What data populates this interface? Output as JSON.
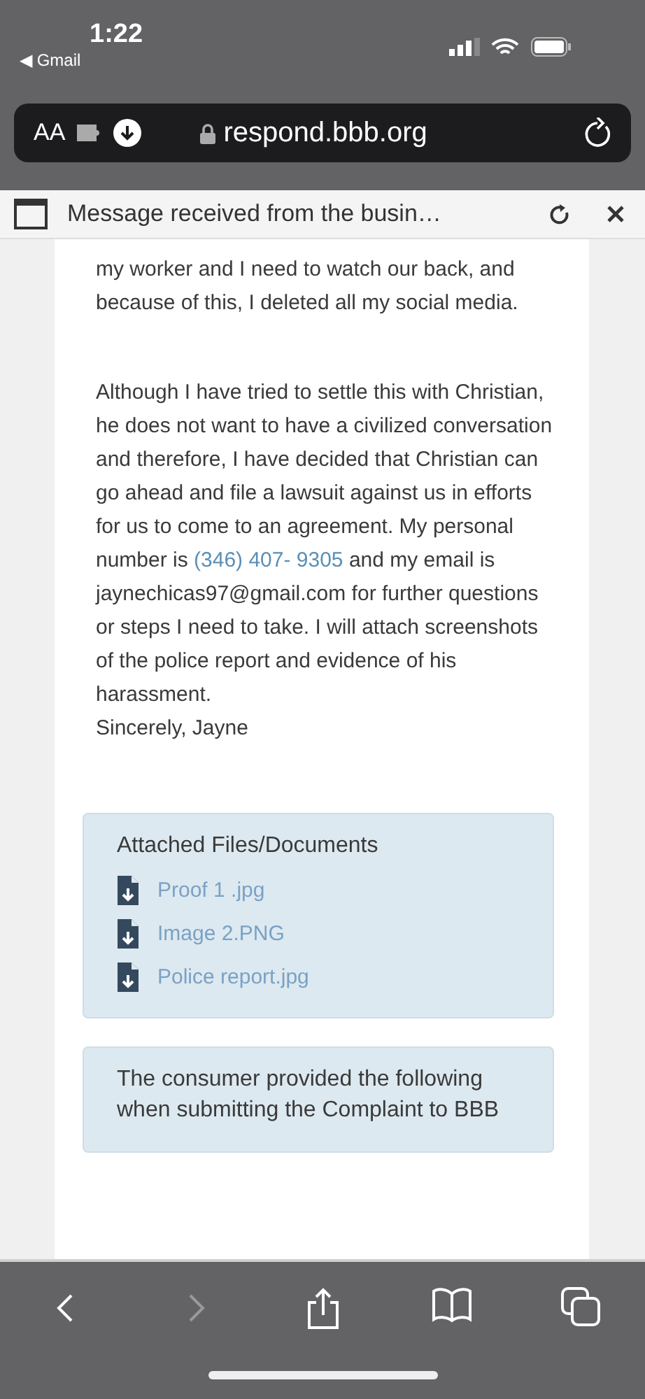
{
  "status_bar": {
    "time": "1:22",
    "back_app": "◀ Gmail"
  },
  "address_bar": {
    "text_size": "AA",
    "url": "respond.bbb.org"
  },
  "header": {
    "title": "Message received from the busin…"
  },
  "message": {
    "paragraphs": [
      {
        "text": "my worker and I need to watch our back, and because of this, I deleted all my social media."
      },
      {
        "before": "Although I have tried to settle this with Christian, he does not want to have a civilized conversation and therefore, I have decided that Christian can go ahead and file a lawsuit against us in efforts for us to come to an agreement. My personal number is ",
        "link": "(346) 407- 9305",
        "after": " and my email is jaynechicas97@gmail.com for further questions or steps I need to take. I will attach screenshots of the police report and evidence of his harassment."
      }
    ],
    "signature": "Sincerely, Jayne"
  },
  "attachments": {
    "title": "Attached Files/Documents",
    "files": [
      "Proof 1 .jpg",
      "Image 2.PNG",
      "Police report.jpg"
    ]
  },
  "consumer_box": {
    "title": "The consumer provided the following when submitting the Complaint to BBB"
  },
  "toolbar": {
    "back_disabled": false,
    "forward_disabled": true
  }
}
